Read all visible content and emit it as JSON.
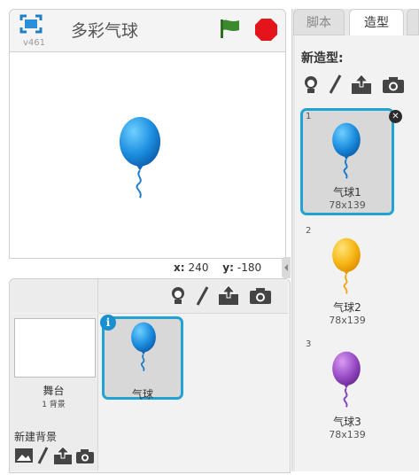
{
  "stage_header": {
    "version": "v461",
    "project_title": "多彩气球"
  },
  "coords": {
    "x_label": "x:",
    "x_value": "240",
    "y_label": "y:",
    "y_value": "-180"
  },
  "sprite_pane": {
    "stage_label": "舞台",
    "stage_sub": "1 背景",
    "new_backdrop_label": "新建背景",
    "sprite_name": "气球"
  },
  "right_panel": {
    "tabs": [
      {
        "label": "脚本"
      },
      {
        "label": "造型"
      }
    ],
    "new_costume_label": "新造型:",
    "costumes": [
      {
        "number": "1",
        "name": "气球1",
        "size": "78x139",
        "color": "#1e8fe0"
      },
      {
        "number": "2",
        "name": "气球2",
        "size": "78x139",
        "color": "#f6b817"
      },
      {
        "number": "3",
        "name": "气球3",
        "size": "78x139",
        "color": "#9b4fc8"
      }
    ]
  },
  "colors": {
    "selection_blue": "#21a1d4",
    "flag_green": "#3c8a2e",
    "stop_red": "#e4141b"
  }
}
